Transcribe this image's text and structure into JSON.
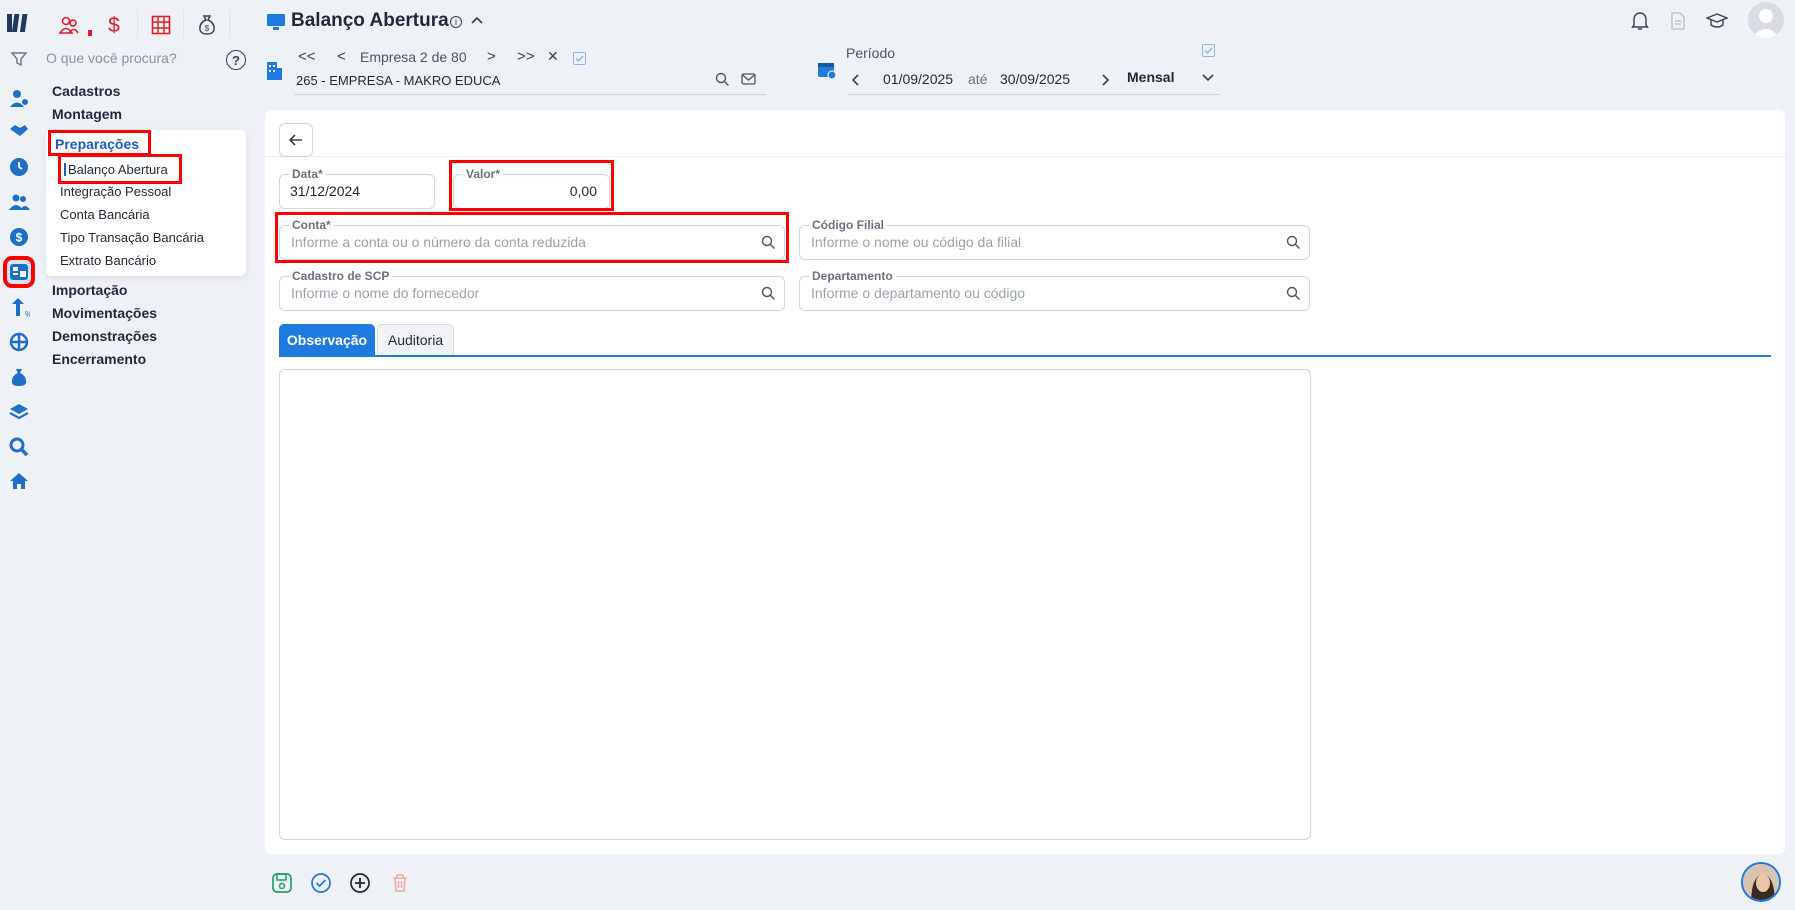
{
  "sidebar": {
    "search_placeholder": "O que você procura?",
    "help_symbol": "?",
    "menu": {
      "cadastros": "Cadastros",
      "montagem": "Montagem",
      "preparacoes": "Preparações",
      "preparacoes_items": [
        "Balanço Abertura",
        "Integração Pessoal",
        "Conta Bancária",
        "Tipo Transação Bancária",
        "Extrato Bancário"
      ],
      "importacao": "Importação",
      "movimentacoes": "Movimentações",
      "demonstracoes": "Demonstrações",
      "encerramento": "Encerramento"
    }
  },
  "header": {
    "title": "Balanço Abertura",
    "info_symbol": "i",
    "nav": {
      "first": "<<",
      "prev": "<",
      "next": ">",
      "last": ">>",
      "close": "✕"
    },
    "empresa_counter": "Empresa 2 de 80",
    "empresa_name": "265 - EMPRESA - MAKRO EDUCA"
  },
  "periodo": {
    "label": "Período",
    "from": "01/09/2025",
    "ate": "até",
    "to": "30/09/2025",
    "mode": "Mensal"
  },
  "form": {
    "data": {
      "label": "Data*",
      "value": "31/12/2024"
    },
    "valor": {
      "label": "Valor*",
      "value": "0,00"
    },
    "conta": {
      "label": "Conta*",
      "placeholder": "Informe a conta ou o número da conta reduzida"
    },
    "codigo_filial": {
      "label": "Código Filial",
      "placeholder": "Informe o nome ou código da filial"
    },
    "cadastro_scp": {
      "label": "Cadastro de SCP",
      "placeholder": "Informe o nome do fornecedor"
    },
    "departamento": {
      "label": "Departamento",
      "placeholder": "Informe o departamento ou código"
    }
  },
  "tabs": [
    {
      "label": "Observação",
      "active": true
    },
    {
      "label": "Auditoria",
      "active": false
    }
  ],
  "observacao_text": "",
  "colors": {
    "accent": "#1f7ae0",
    "highlight": "#ff0000",
    "brand": "#1e3a5f"
  }
}
